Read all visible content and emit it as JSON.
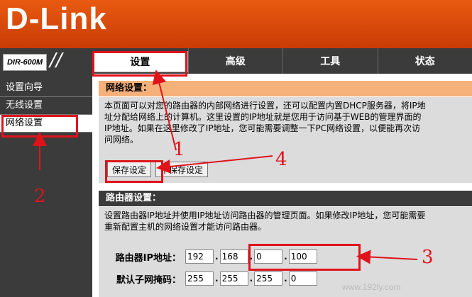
{
  "brand": {
    "logo_text": "D-Link",
    "model": "DIR-600M"
  },
  "tabs": [
    {
      "label": "设置"
    },
    {
      "label": "高级"
    },
    {
      "label": "工具"
    },
    {
      "label": "状态"
    }
  ],
  "sidebar": {
    "items": [
      {
        "label": "设置向导"
      },
      {
        "label": "无线设置"
      },
      {
        "label": "网络设置"
      }
    ]
  },
  "network_settings": {
    "title": "网络设置：",
    "lines": [
      "本页面可以对您的路由器的内部网络进行设置，还可以配置内置DHCP服务器，将IP地",
      "址分配给网络上的计算机。这里设置的IP地址就是您用于访问基于WEB的管理界面的",
      "IP地址。如果在这里修改了IP地址，您可能需要调整一下PC网络设置，以便能再次访",
      "问网络。"
    ],
    "save_label": "保存设定",
    "nosave_label": "不保存设定"
  },
  "router_settings": {
    "title": "路由器设置：",
    "lines": [
      "设置路由器IP地址并使用IP地址访问路由器的管理页面。如果修改IP地址，您可能需要",
      "重新配置主机的网络设置才能访问路由器。"
    ],
    "ip_label": "路由器IP地址：",
    "ip": [
      "192",
      "168",
      "0",
      "100"
    ],
    "mask_label": "默认子网掩码：",
    "mask": [
      "255",
      "255",
      "255",
      "0"
    ]
  },
  "annotations": [
    "1",
    "2",
    "3",
    "4"
  ],
  "annotation_color": "#e0131b",
  "accent_color": "#e95a10",
  "watermark": "www.192ly.com"
}
